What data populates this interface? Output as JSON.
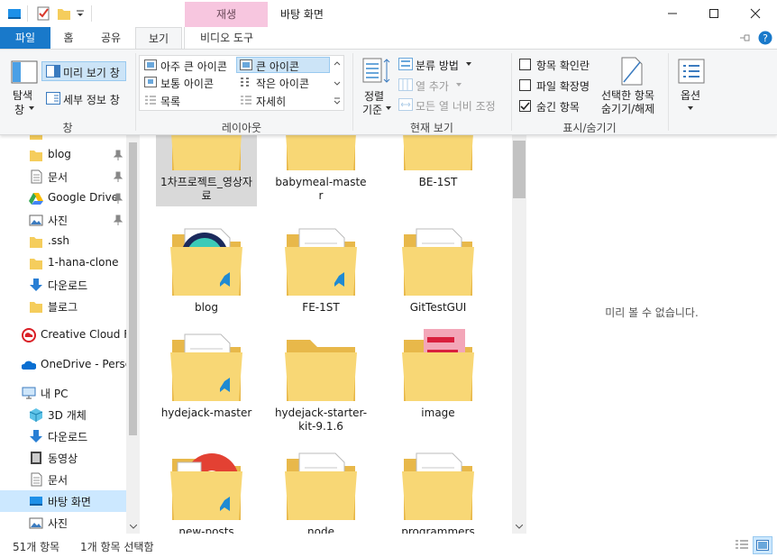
{
  "window": {
    "title": "바탕 화면",
    "context_tab_header": "재생",
    "controls": [
      "minimize-icon",
      "maximize-icon",
      "close-icon"
    ]
  },
  "tabs": [
    {
      "label": "파일"
    },
    {
      "label": "홈"
    },
    {
      "label": "공유"
    },
    {
      "label": "보기"
    },
    {
      "label": "비디오 도구"
    }
  ],
  "ribbon": {
    "pane": {
      "nav_pane": "탐색",
      "nav_pane_2": "창",
      "preview_pane": "미리 보기 창",
      "details_pane": "세부 정보 창",
      "group_label": "창"
    },
    "layout": {
      "options": [
        "아주 큰 아이콘",
        "큰 아이콘",
        "보통 아이콘",
        "작은 아이콘",
        "목록",
        "자세히"
      ],
      "selected": "큰 아이콘",
      "group_label": "레이아웃"
    },
    "current_view": {
      "sort_by_1": "정렬",
      "sort_by_2": "기준",
      "group_by": "분류 방법",
      "add_columns": "열 추가",
      "size_all_columns": "모든 열 너비 조정",
      "group_label": "현재 보기"
    },
    "show_hide": {
      "item_checkboxes": "항목 확인란",
      "file_extensions": "파일 확장명",
      "hidden_items": "숨긴 항목",
      "hide_selected_1": "선택한 항목",
      "hide_selected_2": "숨기기/해제",
      "group_label": "표시/숨기기"
    },
    "options": {
      "label": "옵션"
    }
  },
  "nav": {
    "items": [
      {
        "label": "blog",
        "icon": "folder-icon",
        "pinned": true
      },
      {
        "label": "문서",
        "icon": "document-folder-icon",
        "pinned": true
      },
      {
        "label": "Google Drive",
        "icon": "google-drive-icon",
        "pinned": true
      },
      {
        "label": "사진",
        "icon": "pictures-icon",
        "pinned": true
      },
      {
        "label": ".ssh",
        "icon": "folder-icon",
        "pinned": false
      },
      {
        "label": "1-hana-clone",
        "icon": "folder-icon",
        "pinned": false
      },
      {
        "label": "다운로드",
        "icon": "download-icon",
        "pinned": false
      },
      {
        "label": "블로그",
        "icon": "folder-icon",
        "pinned": false
      },
      {
        "label": "Creative Cloud Fil",
        "icon": "creative-cloud-icon",
        "pinned": false
      },
      {
        "label": "OneDrive - Person",
        "icon": "onedrive-icon",
        "pinned": false
      },
      {
        "label": "내 PC",
        "icon": "pc-icon",
        "pinned": false
      },
      {
        "label": "3D 개체",
        "icon": "3d-objects-icon",
        "pinned": false
      },
      {
        "label": "다운로드",
        "icon": "download-icon",
        "pinned": false
      },
      {
        "label": "동영상",
        "icon": "videos-icon",
        "pinned": false
      },
      {
        "label": "문서",
        "icon": "document-folder-icon",
        "pinned": false
      },
      {
        "label": "바탕 화면",
        "icon": "desktop-icon",
        "pinned": false,
        "selected": true
      },
      {
        "label": "사진",
        "icon": "pictures-icon",
        "pinned": false
      }
    ]
  },
  "content": {
    "items": [
      {
        "name": "1차프로젝트_영상자료",
        "selected": true,
        "kind": "images"
      },
      {
        "name": "babymeal-master",
        "kind": "docs"
      },
      {
        "name": "BE-1ST",
        "kind": "docs"
      },
      {
        "name": "blog",
        "kind": "vscode-app"
      },
      {
        "name": "FE-1ST",
        "kind": "vscode-json"
      },
      {
        "name": "GitTestGUI",
        "kind": "docs"
      },
      {
        "name": "hydejack-master",
        "kind": "vscode"
      },
      {
        "name": "hydejack-starter-kit-9.1.6",
        "kind": "plain"
      },
      {
        "name": "image",
        "kind": "pink"
      },
      {
        "name": "new-posts",
        "kind": "chrome"
      },
      {
        "name": "node",
        "kind": "docs"
      },
      {
        "name": "programmers",
        "kind": "docs"
      }
    ]
  },
  "preview": {
    "empty_text": "미리 볼 수 없습니다."
  },
  "status": {
    "item_count": "51개 항목",
    "selection": "1개 항목 선택함"
  }
}
